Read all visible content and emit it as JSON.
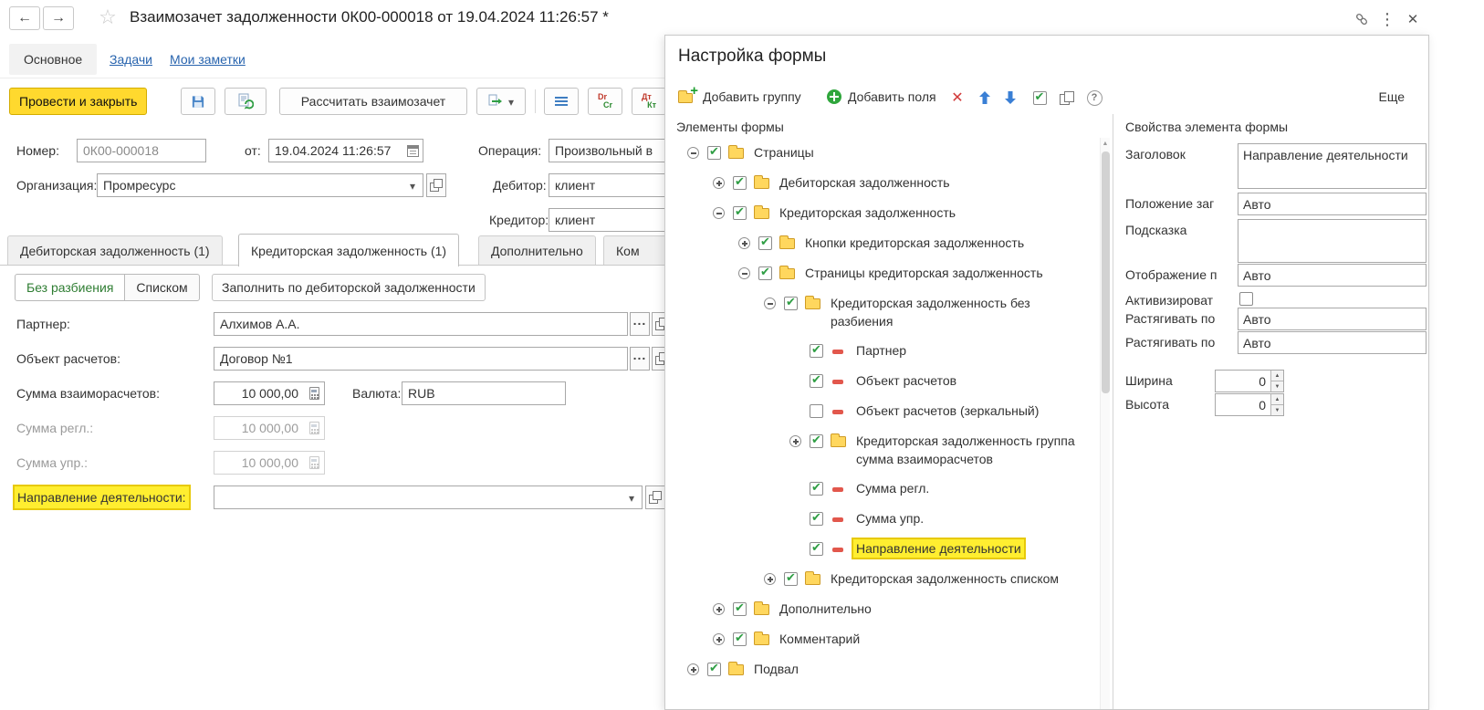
{
  "window": {
    "titlebar": {
      "title": "Взаимозачет задолженности 0К00-000018 от 19.04.2024 11:26:57 *"
    },
    "nav": {
      "main_tab": "Основное",
      "tasks_link": "Задачи",
      "notes_link": "Мои заметки"
    },
    "commands": {
      "post_and_close": "Провести и закрыть",
      "calculate_offset": "Рассчитать взаимозачет",
      "dr": "Dr",
      "cr": "Cr",
      "dt": "Дт",
      "kt": "Кт"
    },
    "header": {
      "number_label": "Номер:",
      "number_value": "0К00-000018",
      "date_label": "от:",
      "date_value": "19.04.2024 11:26:57",
      "operation_label": "Операция:",
      "operation_value": "Произвольный в",
      "organization_label": "Организация:",
      "organization_value": "Промресурс",
      "debtor_label": "Дебитор:",
      "debtor_value": "клиент",
      "creditor_label": "Кредитор:",
      "creditor_value": "клиент"
    },
    "tabs": {
      "receivable": "Дебиторская задолженность (1)",
      "payable": "Кредиторская задолженность (1)",
      "additional": "Дополнительно",
      "comment": "Ком"
    },
    "body": {
      "no_split": "Без разбиения",
      "as_list": "Списком",
      "fill_from_receivable": "Заполнить по дебиторской задолженности",
      "partner_label": "Партнер:",
      "partner_value": "Алхимов А.А.",
      "settlement_object_label": "Объект расчетов:",
      "settlement_object_value": "Договор №1",
      "amount_label": "Сумма взаиморасчетов:",
      "amount_value": "10 000,00",
      "currency_label": "Валюта:",
      "currency_value": "RUB",
      "amount_reg_label": "Сумма регл.:",
      "amount_reg_value": "10 000,00",
      "amount_mgmt_label": "Сумма упр.:",
      "amount_mgmt_value": "10 000,00",
      "direction_label": "Направление деятельности:"
    }
  },
  "dialog": {
    "title": "Настройка формы",
    "toolbar": {
      "add_group": "Добавить группу",
      "add_fields": "Добавить поля",
      "more": "Еще"
    },
    "tree_panel_title": "Элементы формы",
    "tree": [
      {
        "label": "Страницы",
        "checked": true
      },
      {
        "label": "Дебиторская задолженность",
        "checked": true
      },
      {
        "label": "Кредиторская задолженность",
        "checked": true
      },
      {
        "label": "Кнопки кредиторская задолженность",
        "checked": true
      },
      {
        "label": "Страницы кредиторская задолженность",
        "checked": true
      },
      {
        "label": "Кредиторская задолженность без разбиения",
        "checked": true
      },
      {
        "label": "Партнер",
        "checked": true
      },
      {
        "label": "Объект расчетов",
        "checked": true
      },
      {
        "label": "Объект расчетов (зеркальный)",
        "checked": false
      },
      {
        "label": "Кредиторская задолженность группа сумма взаиморасчетов",
        "checked": true
      },
      {
        "label": "Сумма регл.",
        "checked": true
      },
      {
        "label": "Сумма упр.",
        "checked": true
      },
      {
        "label": "Направление деятельности",
        "checked": true,
        "highlighted": true
      },
      {
        "label": "Кредиторская задолженность списком",
        "checked": true
      },
      {
        "label": "Дополнительно",
        "checked": true
      },
      {
        "label": "Комментарий",
        "checked": true
      },
      {
        "label": "Подвал",
        "checked": true
      }
    ],
    "props": {
      "panel_title": "Свойства элемента формы",
      "caption_label": "Заголовок",
      "caption_value": "Направление деятельности",
      "caption_position_label": "Положение заг",
      "caption_position_value": "Авто",
      "tooltip_label": "Подсказка",
      "tooltip_value": "",
      "display_label": "Отображение п",
      "display_value": "Авто",
      "activate_label": "Активизироват",
      "stretch_h_label": "Растягивать по",
      "stretch_h_value": "Авто",
      "stretch_v_label": "Растягивать по",
      "stretch_v_value": "Авто",
      "width_label": "Ширина",
      "width_value": "0",
      "height_label": "Высота",
      "height_value": "0"
    }
  }
}
